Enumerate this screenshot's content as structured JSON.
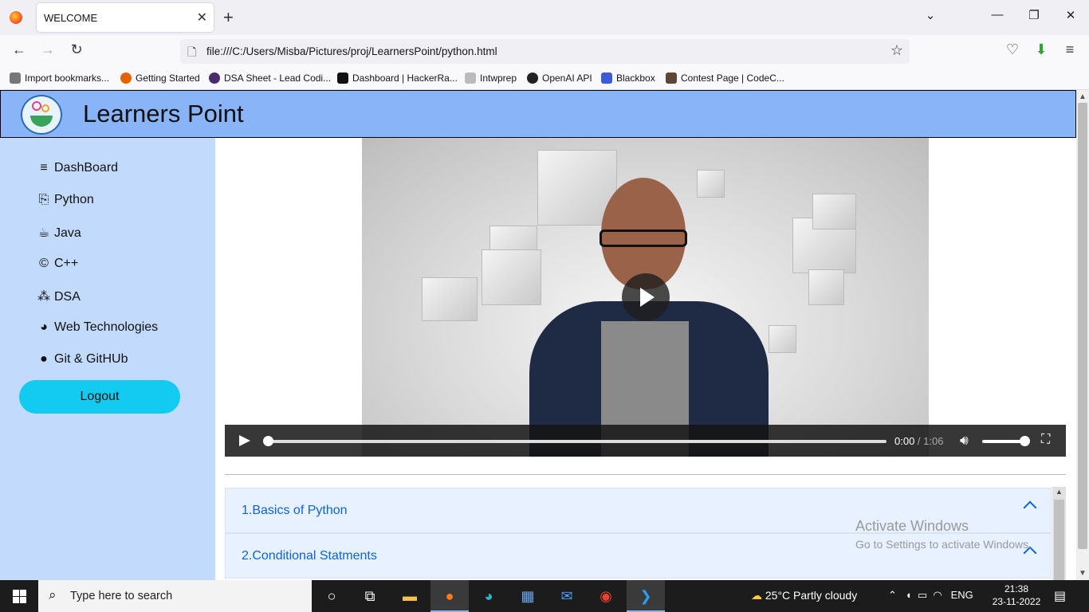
{
  "browser": {
    "tab_title": "WELCOME",
    "new_tab_label": "+",
    "url": "file:///C:/Users/Misba/Pictures/proj/LearnersPoint/python.html",
    "bookmarks": [
      {
        "label": "Import bookmarks...",
        "icon": "import-icon",
        "color": "#555555"
      },
      {
        "label": "Getting Started",
        "icon": "firefox-icon",
        "color": "#e66000"
      },
      {
        "label": "DSA Sheet - Lead Codi...",
        "icon": "dsa-icon",
        "color": "#4b2a6b"
      },
      {
        "label": "Dashboard | HackerRa...",
        "icon": "hackerrank-icon",
        "color": "#111111"
      },
      {
        "label": "Intwprep",
        "icon": "intwprep-icon",
        "color": "#888888"
      },
      {
        "label": "OpenAI API",
        "icon": "openai-icon",
        "color": "#222222"
      },
      {
        "label": "Blackbox",
        "icon": "blackbox-icon",
        "color": "#3b5bdb"
      },
      {
        "label": "Contest Page | CodeC...",
        "icon": "codechef-icon",
        "color": "#5b4638"
      }
    ]
  },
  "site": {
    "brand": "Learners Point",
    "header_color": "#8ab4f8",
    "sidebar_color": "#c2dafb"
  },
  "sidebar": {
    "items": [
      {
        "label": "DashBoard",
        "icon": "menu-icon",
        "glyph": "≡"
      },
      {
        "label": "Python",
        "icon": "python-icon",
        "glyph": "⎘"
      },
      {
        "label": "Java",
        "icon": "coffee-icon",
        "glyph": "☕"
      },
      {
        "label": "C++",
        "icon": "copyright-icon",
        "glyph": "©"
      },
      {
        "label": "DSA",
        "icon": "sitemap-icon",
        "glyph": "⁂"
      },
      {
        "label": "Web Technologies",
        "icon": "edge-icon",
        "glyph": "◕"
      },
      {
        "label": "Git & GitHUb",
        "icon": "github-icon",
        "glyph": "●"
      }
    ],
    "logout_label": "Logout"
  },
  "video": {
    "current_time": "0:00",
    "separator": " / ",
    "duration": "1:06",
    "progress": 0,
    "volume": 1
  },
  "accordion": [
    {
      "label": "1.Basics of Python"
    },
    {
      "label": "2.Conditional Statments"
    }
  ],
  "watermark": {
    "line1": "Activate Windows",
    "line2": "Go to Settings to activate Windows."
  },
  "taskbar": {
    "search_placeholder": "Type here to search",
    "weather": "25°C  Partly cloudy",
    "language": "ENG",
    "time": "21:38",
    "date": "23-11-2022"
  }
}
